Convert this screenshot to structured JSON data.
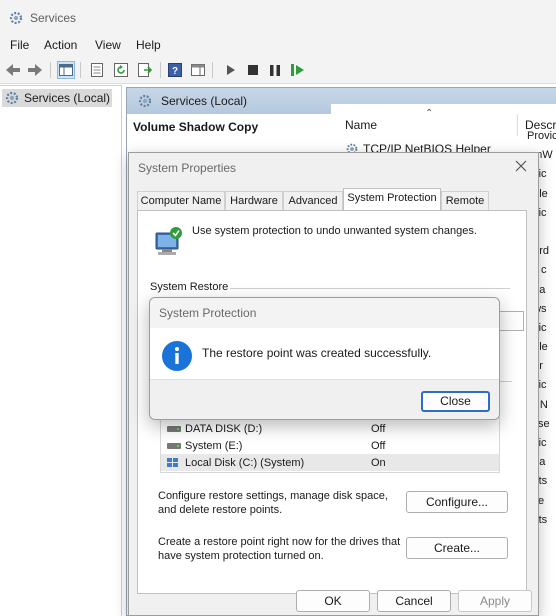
{
  "window": {
    "title": "Services"
  },
  "menu": [
    "File",
    "Action",
    "View",
    "Help"
  ],
  "tree": {
    "item": "Services (Local)"
  },
  "pane": {
    "header": "Services (Local)",
    "detail_title": "Volume Shadow Copy"
  },
  "list": {
    "col_name": "Name",
    "col_desc": "Descri",
    "row_name": "TCP/IP NetBIOS Helper",
    "desc_fragments": [
      "Provic",
      "amW",
      "ovic",
      "able",
      "ovic",
      "",
      "eord",
      "ell c",
      "ana",
      "ows",
      "ovic",
      "ndle",
      "el(r",
      "ovic",
      "er N",
      "is se",
      "ovic",
      "ana",
      "osts",
      "aile",
      "osts",
      "",
      ""
    ]
  },
  "sysprops": {
    "title": "System Properties",
    "tabs": [
      "Computer Name",
      "Hardware",
      "Advanced",
      "System Protection",
      "Remote"
    ],
    "description": "Use system protection to undo unwanted system changes.",
    "group_restore": "System Restore",
    "drives": [
      {
        "name": "DATA DISK (D:)",
        "status": "Off"
      },
      {
        "name": "System (E:)",
        "status": "Off"
      },
      {
        "name": "Local Disk (C:) (System)",
        "status": "On"
      }
    ],
    "configure_text": "Configure restore settings, manage disk space, and delete restore points.",
    "configure_button": "Configure...",
    "create_text": "Create a restore point right now for the drives that have system protection turned on.",
    "create_button": "Create...",
    "ok": "OK",
    "cancel": "Cancel",
    "apply": "Apply"
  },
  "popup": {
    "title": "System Protection",
    "message": "The restore point was created successfully.",
    "close_button": "Close"
  },
  "colors": {
    "accent": "#2b6fc3",
    "info": "#1a73d9"
  }
}
